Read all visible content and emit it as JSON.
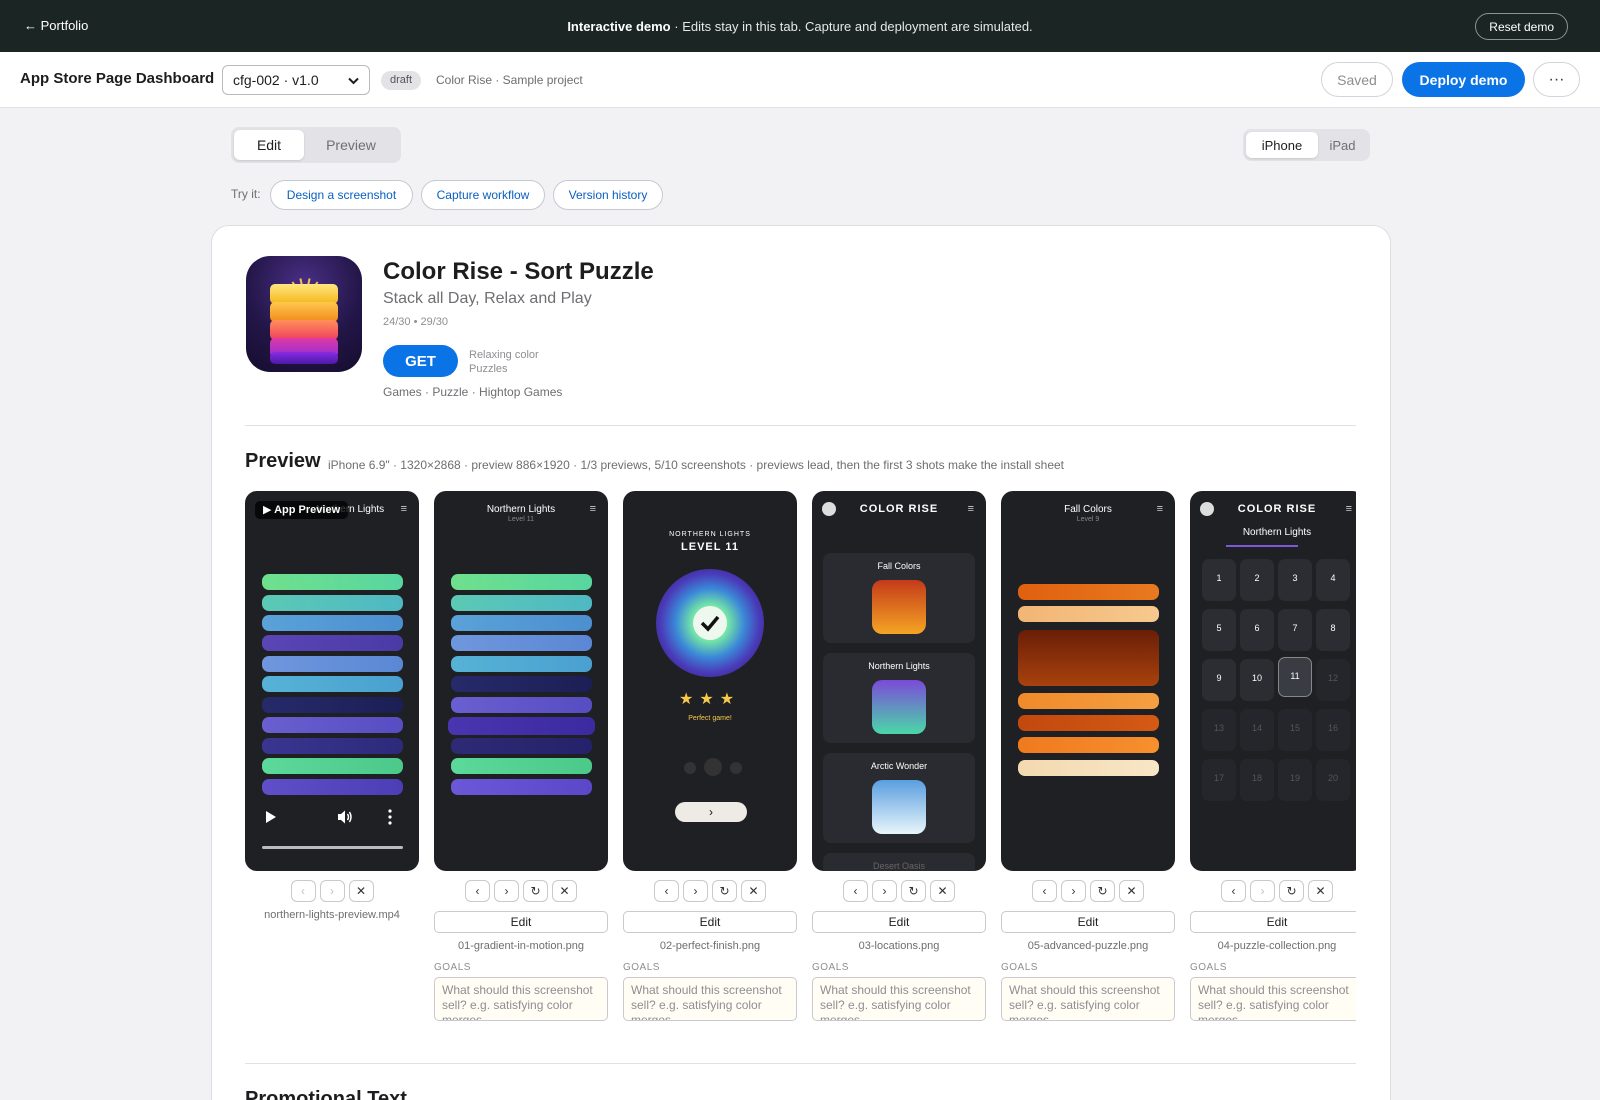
{
  "banner": {
    "back_label": "← Portfolio",
    "demo_bold": "Interactive demo",
    "demo_text": " · Edits stay in this tab. Capture and deployment are simulated.",
    "reset_label": "Reset demo"
  },
  "header": {
    "title": "App Store Page Dashboard",
    "config_value": "cfg-002 · v1.0",
    "badge": "draft",
    "project": "Color Rise · Sample project",
    "saved_label": "Saved",
    "deploy_label": "Deploy demo",
    "more_label": "···"
  },
  "mode": {
    "edit": "Edit",
    "preview": "Preview",
    "selected": "Edit"
  },
  "device": {
    "iphone": "iPhone",
    "ipad": "iPad",
    "selected": "iPhone"
  },
  "tryit": {
    "label": "Try it:",
    "chips": [
      "Design a screenshot",
      "Capture workflow",
      "Version history"
    ]
  },
  "app": {
    "title": "Color Rise - Sort Puzzle",
    "subtitle": "Stack all Day, Relax and Play",
    "counts": "24/30 • 29/30",
    "get_label": "GET",
    "get_hint": "Relaxing color Puzzles",
    "categories": "Games · Puzzle · Hightop Games"
  },
  "preview": {
    "title": "Preview",
    "meta": "iPhone 6.9\" · 1320×2868 · preview 886×1920 · 1/3 previews, 5/10 screenshots · previews lead, then the first 3 shots make the install sheet",
    "goals_label": "GOALS",
    "goals_placeholder": "What should this screenshot sell? e.g. satisfying color merges",
    "edit_label": "Edit",
    "items": [
      {
        "file": "northern-lights-preview.mp4",
        "kind": "video",
        "badge": "▶ App Preview",
        "header": "Northern Lights"
      },
      {
        "file": "01-gradient-in-motion.png",
        "kind": "bars",
        "header": "Northern Lights",
        "sub": "Level 11"
      },
      {
        "file": "02-perfect-finish.png",
        "kind": "finish",
        "header": "NORTHERN LIGHTS",
        "level": "LEVEL 11",
        "perfect": "Perfect game!"
      },
      {
        "file": "03-locations.png",
        "kind": "locations",
        "logo": "COLOR RISE",
        "locations": [
          "Fall Colors",
          "Northern Lights",
          "Arctic Wonder",
          "Desert Oasis"
        ]
      },
      {
        "file": "05-advanced-puzzle.png",
        "kind": "fall",
        "header": "Fall Colors",
        "sub": "Level 9"
      },
      {
        "file": "04-puzzle-collection.png",
        "kind": "levels",
        "logo": "COLOR RISE",
        "header": "Northern Lights"
      }
    ]
  },
  "promo": {
    "title": "Promotional Text"
  },
  "colors": {
    "accent": "#0a73e6",
    "banner_bg": "#1b2524",
    "phone_bg": "#1f2024"
  }
}
